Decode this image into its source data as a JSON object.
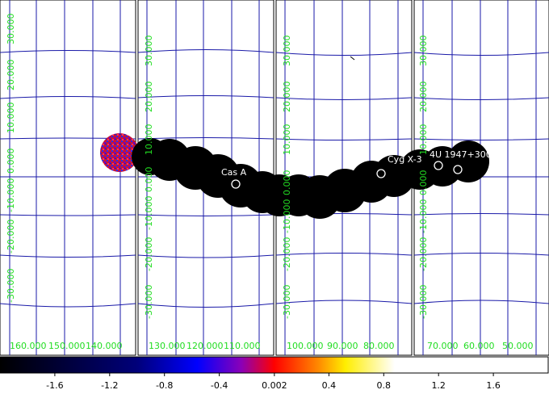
{
  "colors": {
    "panel_bg": "#ffffff",
    "panel_border": "#000000",
    "grid": "#1a1aa8",
    "grid_label": "#22dd22",
    "blob": "#000000",
    "marker": "#ffffff"
  },
  "panels": [
    {
      "id": "panel-1",
      "lon_labels": [
        "160.000",
        "150.000",
        "140.000"
      ],
      "lat_labels": [
        "30.000",
        "20.000",
        "10.000",
        "0.000",
        "-10.000",
        "-20.000",
        "-30.000"
      ]
    },
    {
      "id": "panel-2",
      "lon_labels": [
        "130.000",
        "120.000",
        "110.000"
      ],
      "lat_labels": [
        "30.000",
        "20.000",
        "10.000",
        "0.000",
        "-10.000",
        "-20.000",
        "-30.000"
      ]
    },
    {
      "id": "panel-3",
      "lon_labels": [
        "100.000",
        "90.000",
        "80.000"
      ],
      "lat_labels": [
        "30.000",
        "20.000",
        "10.000",
        "0.000",
        "-10.000",
        "-20.000",
        "-30.000"
      ]
    },
    {
      "id": "panel-4",
      "lon_labels": [
        "70.000",
        "60.000",
        "50.000"
      ],
      "lat_labels": [
        "30.000",
        "20.000",
        "10.000",
        "0.000",
        "-10.000",
        "-20.000",
        "-30.000"
      ]
    }
  ],
  "sources": [
    {
      "name": "Cas A",
      "label": "Cas A"
    },
    {
      "name": "Cyg X-3",
      "label": "Cyg X-3"
    },
    {
      "name": "4U 1947+300",
      "label": "4U 1947+300"
    },
    {
      "name": "unlabeled-1",
      "label": ""
    }
  ],
  "colorbar": {
    "ticks": [
      "-1.6",
      "-1.2",
      "-0.8",
      "-0.4",
      "0.002",
      "0.4",
      "0.8",
      "1.2",
      "1.6"
    ],
    "range": [
      -2.0,
      2.0
    ],
    "stops": [
      "#000000",
      "#00007a",
      "#0000ff",
      "#8a00b8",
      "#ff0000",
      "#ff8800",
      "#ffee00",
      "#ffffff"
    ]
  }
}
